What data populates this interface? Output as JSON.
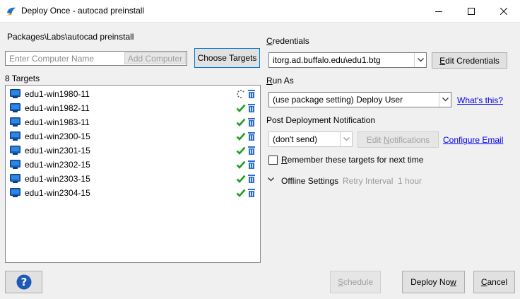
{
  "window": {
    "title": "Deploy Once - autocad preinstall"
  },
  "path": "Packages\\Labs\\autocad preinstall",
  "computer_input": {
    "placeholder": "Enter Computer Name",
    "value": ""
  },
  "add_computer_label": "Add Computer",
  "choose_targets_label": "Choose Targets",
  "targets_count_label": "8 Targets",
  "targets": [
    {
      "name": "edu1-win1980-11",
      "status": "pending"
    },
    {
      "name": "edu1-win1982-11",
      "status": "ok"
    },
    {
      "name": "edu1-win1983-11",
      "status": "ok"
    },
    {
      "name": "edu1-win2300-15",
      "status": "ok"
    },
    {
      "name": "edu1-win2301-15",
      "status": "ok"
    },
    {
      "name": "edu1-win2302-15",
      "status": "ok"
    },
    {
      "name": "edu1-win2303-15",
      "status": "ok"
    },
    {
      "name": "edu1-win2304-15",
      "status": "ok"
    }
  ],
  "credentials": {
    "label": "Credentials",
    "value": "itorg.ad.buffalo.edu\\edu1.btg",
    "edit_label": "Edit Credentials"
  },
  "run_as": {
    "label": "Run As",
    "value": "(use package setting) Deploy User",
    "help_link": "What's this?"
  },
  "notification": {
    "label": "Post Deployment Notification",
    "value": "(don't send)",
    "edit_label": "Edit Notifications",
    "configure_link": "Configure Email"
  },
  "remember_targets": {
    "label": "Remember these targets for next time",
    "checked": false
  },
  "offline": {
    "label": "Offline Settings",
    "retry_text": "Retry Interval  1 hour"
  },
  "footer": {
    "schedule_label": "Schedule",
    "deploy_now_label": "Deploy Now",
    "cancel_label": "Cancel",
    "help_glyph": "?"
  },
  "colors": {
    "accent": "#0078d7",
    "check_green": "#1e9e1e",
    "trash_blue": "#2b6fd6",
    "pc_blue": "#1565c0",
    "help_blue": "#1e5ab4"
  }
}
